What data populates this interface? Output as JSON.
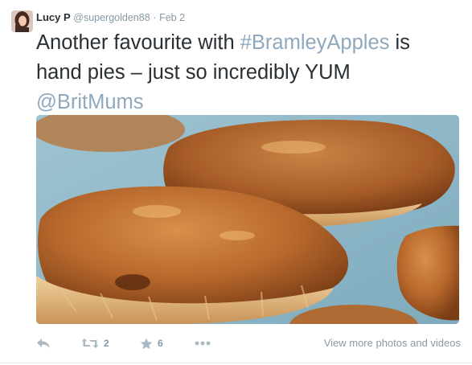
{
  "tweet": {
    "display_name": "Lucy P",
    "handle": "@supergolden88",
    "separator": "·",
    "time": "Feb 2",
    "text_part1": "Another favourite with ",
    "hashtag": "#BramleyApples",
    "text_part2": " is hand pies – just so incredibly YUM ",
    "mention": "@BritMums"
  },
  "actions": {
    "retweet_count": "2",
    "favorite_count": "6",
    "view_more": "View more photos and videos"
  },
  "icons": {
    "reply": "reply-icon",
    "retweet": "retweet-icon",
    "favorite": "star-icon",
    "more": "more-dots-icon"
  },
  "colors": {
    "link": "#8fa8be",
    "muted": "#8899a6",
    "text": "#292f33"
  }
}
